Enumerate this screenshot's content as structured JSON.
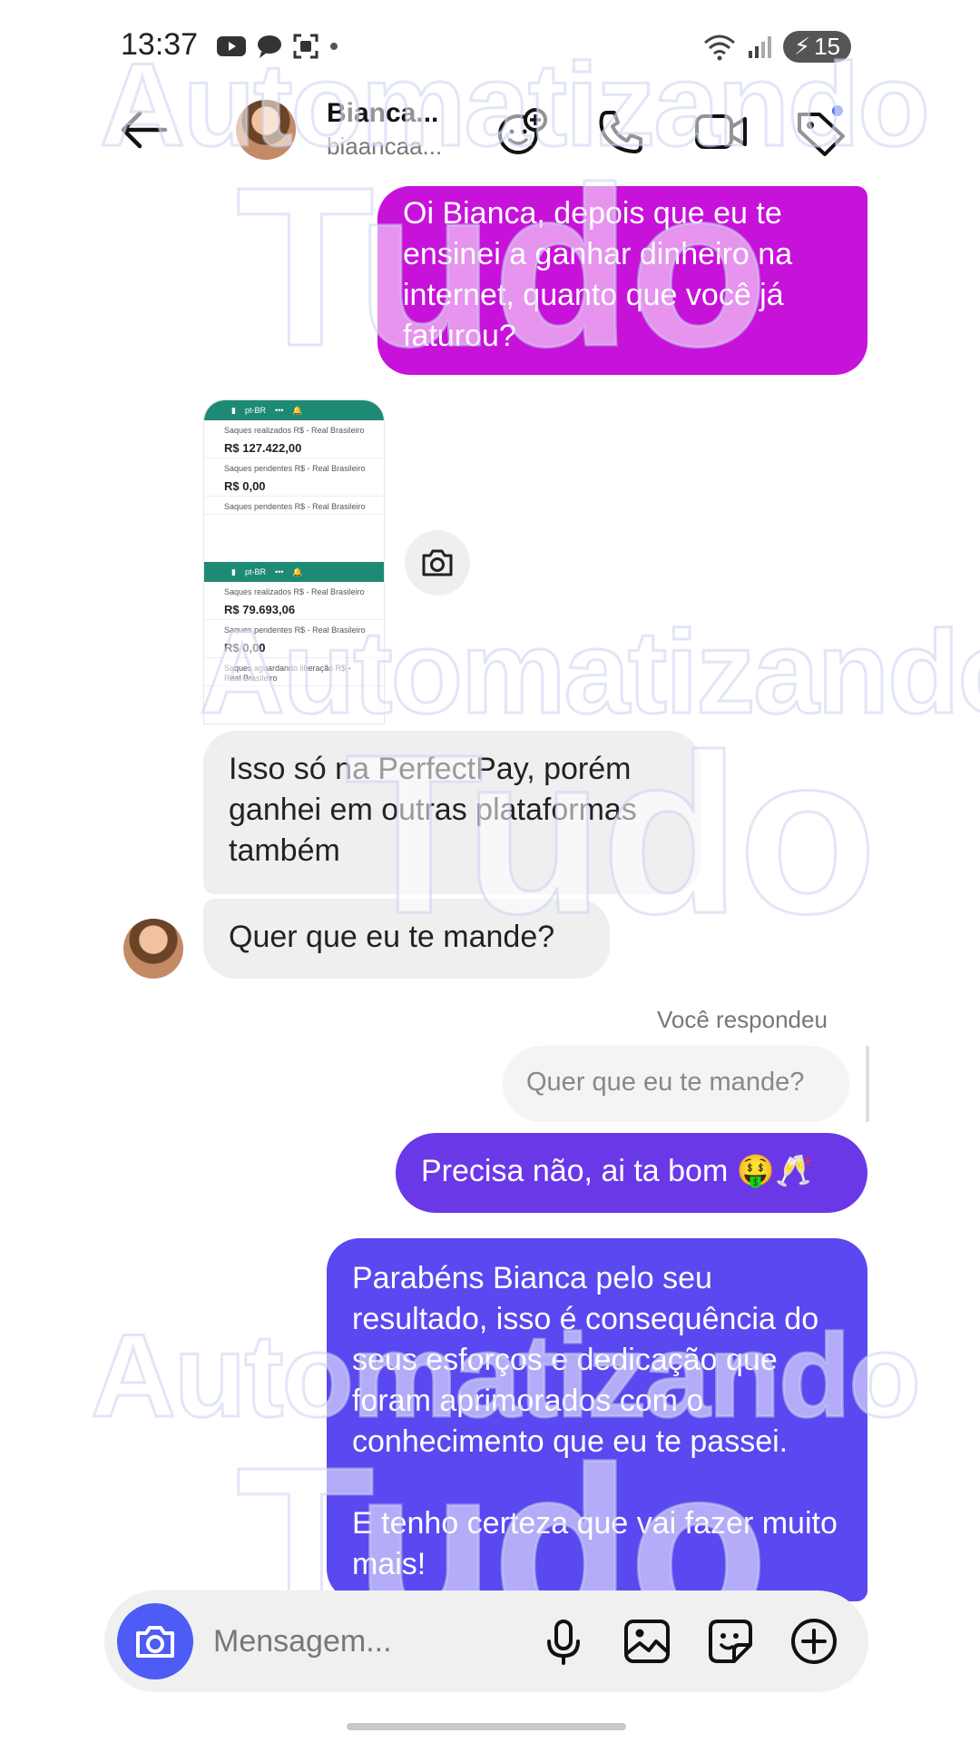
{
  "status_bar": {
    "time": "13:37",
    "battery": "15"
  },
  "header": {
    "name": "Bianca...",
    "username": "biaancaa..."
  },
  "messages": {
    "m1": "Oi Bianca, depois que eu te ensinei a ganhar dinheiro na internet, quanto que você já faturou?",
    "image": {
      "shot1": {
        "lang": "pt-BR",
        "rows": [
          {
            "label": "Saques realizados R$ - Real Brasileiro",
            "value": "R$ 127.422,00"
          },
          {
            "label": "Saques pendentes R$ - Real Brasileiro",
            "value": "R$ 0,00"
          },
          {
            "label": "Saques pendentes R$ - Real Brasileiro",
            "value": ""
          }
        ]
      },
      "shot2": {
        "lang": "pt-BR",
        "rows": [
          {
            "label": "Saques realizados R$ - Real Brasileiro",
            "value": "R$ 79.693,06"
          },
          {
            "label": "Saques pendentes R$ - Real Brasileiro",
            "value": "R$ 0,00"
          },
          {
            "label": "Saques aguardando liberação R$ - Real Brasileiro",
            "value": ""
          }
        ]
      }
    },
    "m2": "Isso só na PerfectPay, porém ganhei em outras plataformas também",
    "m3": "Quer que eu te mande?",
    "reply_label": "Você respondeu",
    "reply_quote": "Quer que eu te mande?",
    "m4": "Precisa não, ai ta bom 🤑🥂",
    "m5": "Parabéns Bianca pelo seu resultado, isso é consequência do seus esforços e dedicação que foram aprimorados com o conhecimento que eu te passei.\n\nE tenho certeza que vai fazer muito mais!"
  },
  "composer": {
    "placeholder": "Mensagem..."
  },
  "watermark": {
    "line1": "Automatizando",
    "line2": "Tudo"
  },
  "colors": {
    "magenta": "#c712d9",
    "violet": "#6b38e8",
    "indigo": "#5a48f0",
    "camera": "#4c5cf5"
  }
}
